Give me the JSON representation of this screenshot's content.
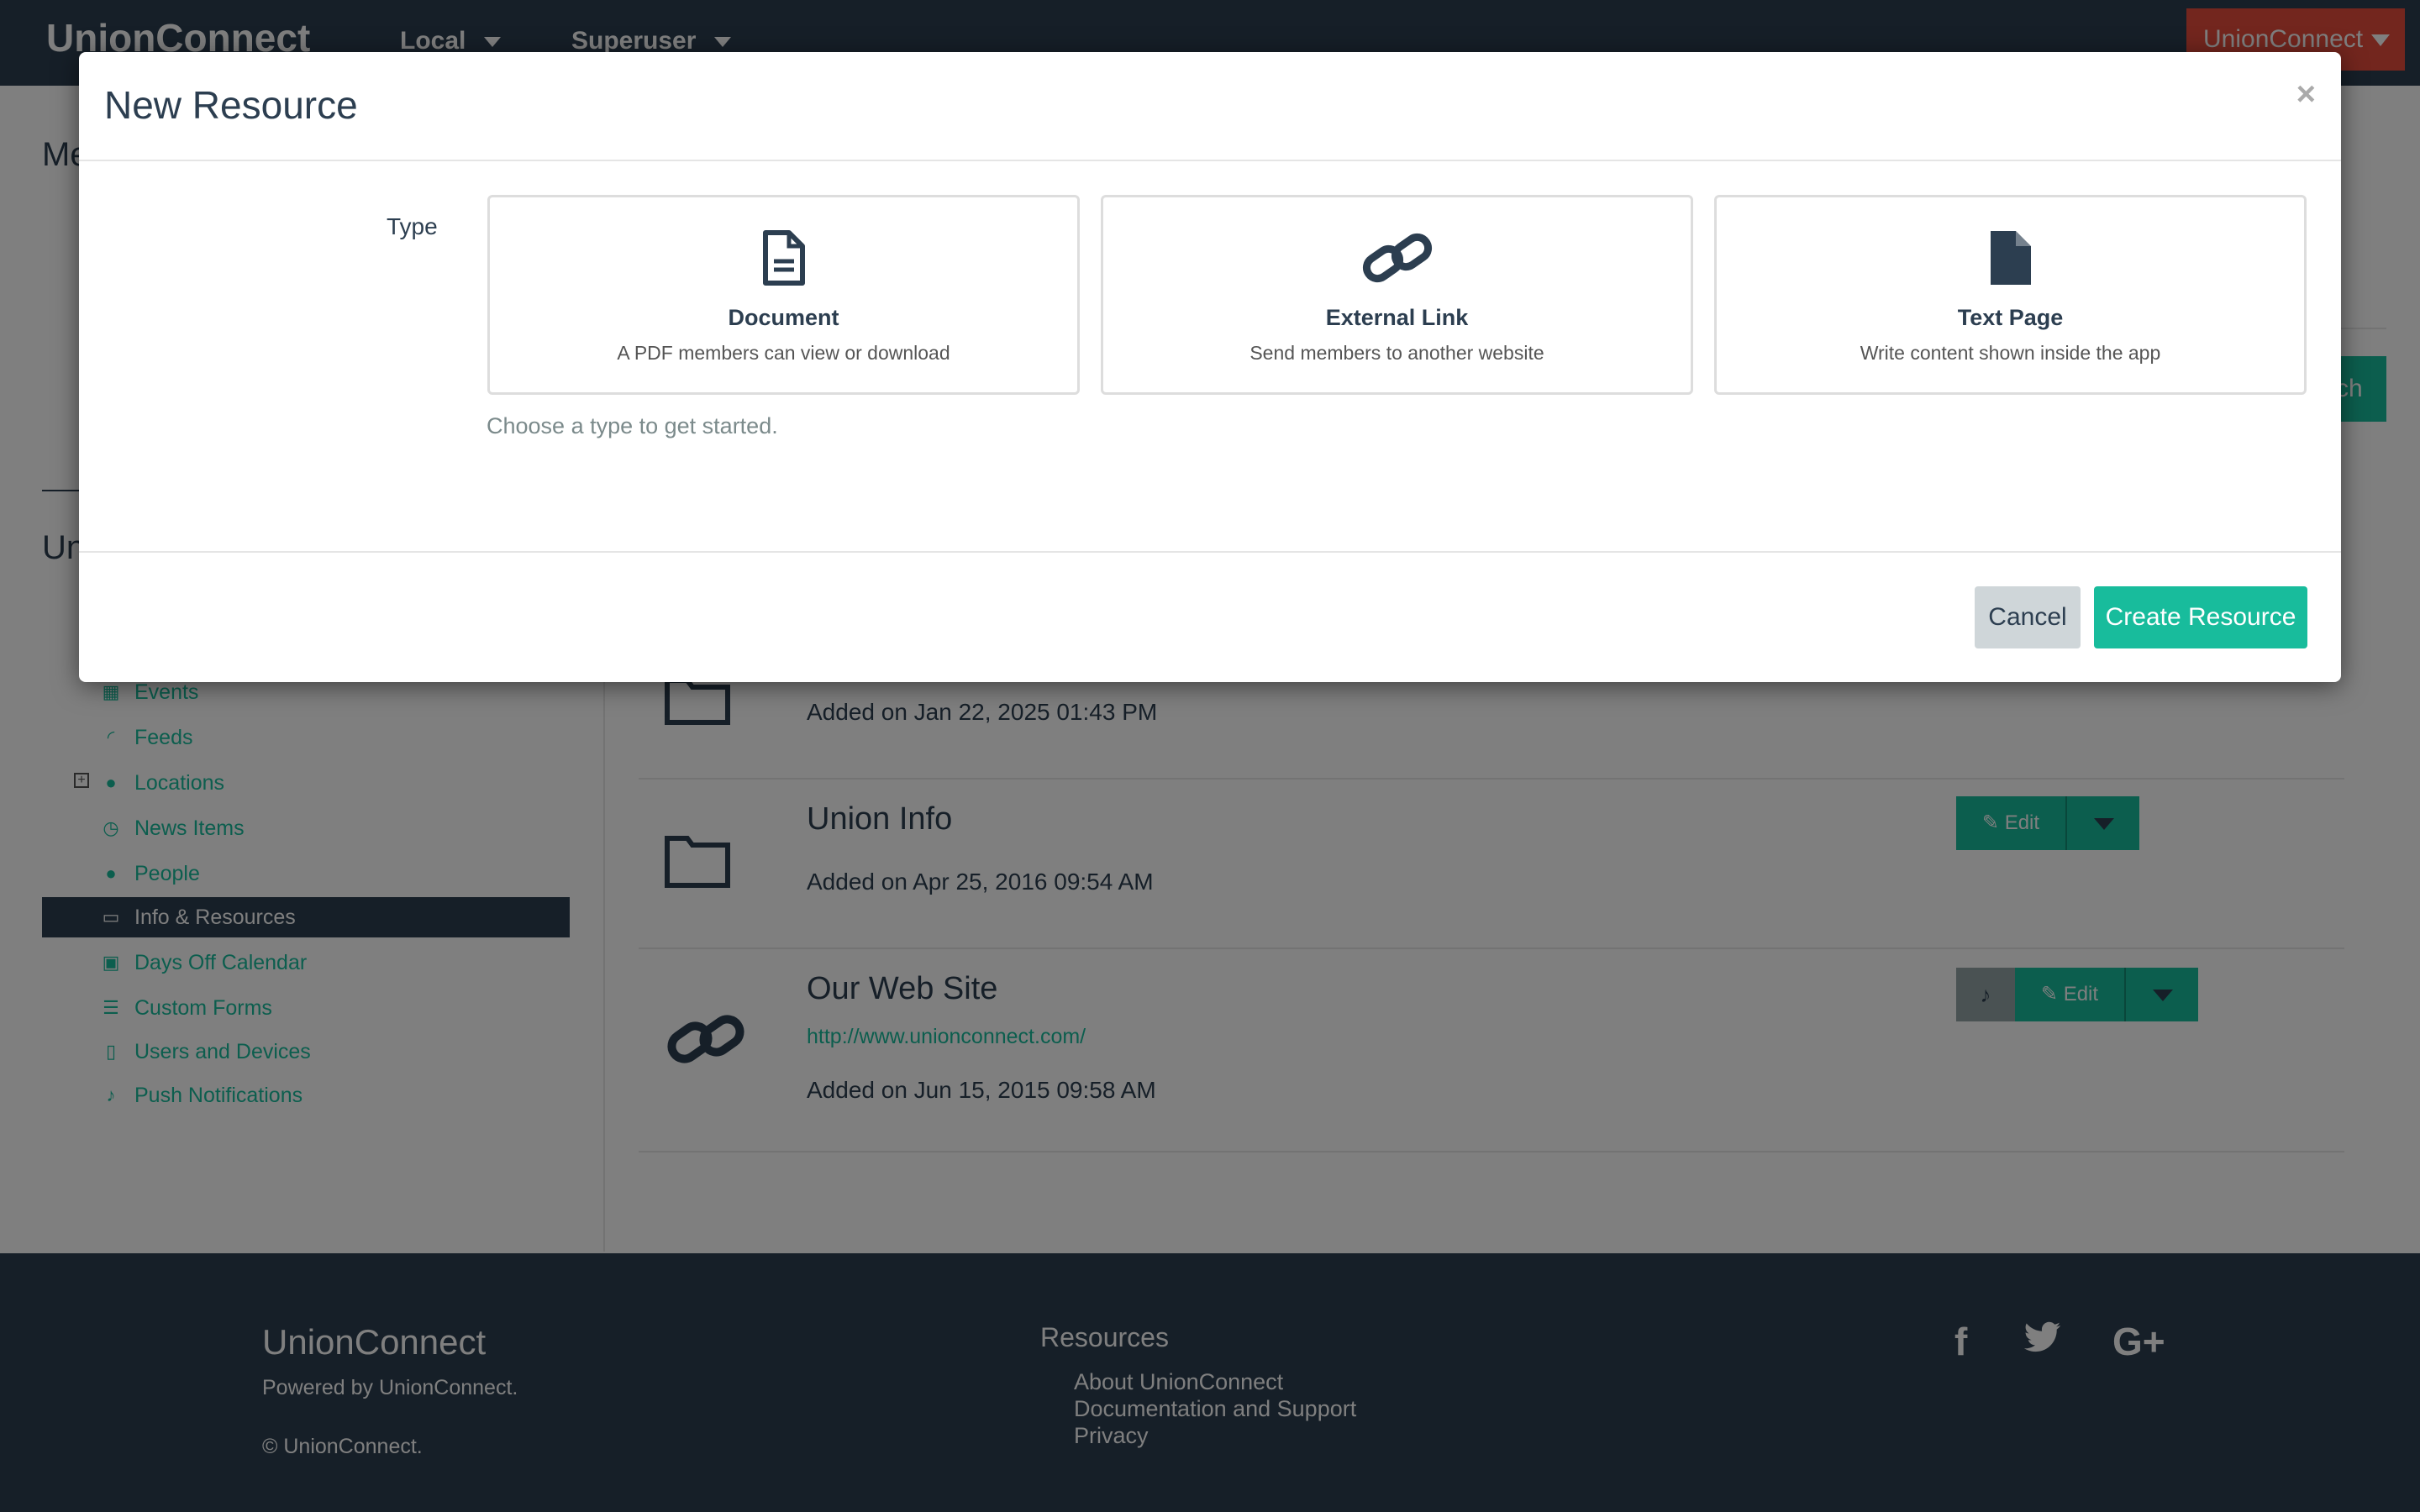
{
  "navbar": {
    "brand": "UnionConnect",
    "local_label": "Local",
    "superuser_label": "Superuser",
    "account_label": "UnionConnect"
  },
  "page": {
    "heading_top": "Me",
    "heading_mid": "Un",
    "search_button": "ch"
  },
  "sidebar": {
    "items": [
      {
        "label": "Events",
        "icon": "calendar-grid-icon"
      },
      {
        "label": "Feeds",
        "icon": "rss-icon"
      },
      {
        "label": "Locations",
        "icon": "globe-icon"
      },
      {
        "label": "News Items",
        "icon": "clock-icon"
      },
      {
        "label": "People",
        "icon": "user-icon"
      },
      {
        "label": "Info & Resources",
        "icon": "folder-open-icon"
      },
      {
        "label": "Days Off Calendar",
        "icon": "calendar-icon"
      },
      {
        "label": "Custom Forms",
        "icon": "list-alt-icon"
      },
      {
        "label": "Users and Devices",
        "icon": "tablet-icon"
      },
      {
        "label": "Push Notifications",
        "icon": "bell-icon"
      }
    ]
  },
  "resources": [
    {
      "title": "",
      "date": "Added on Jan 22, 2025 01:43 PM",
      "icon": "folder-icon"
    },
    {
      "title": "Union Info",
      "date": "Added on Apr 25, 2016 09:54 AM",
      "icon": "folder-icon",
      "edit_label": "Edit"
    },
    {
      "title": "Our Web Site",
      "link": "http://www.unionconnect.com/",
      "date": "Added on Jun 15, 2015 09:58 AM",
      "icon": "link-icon",
      "edit_label": "Edit"
    }
  ],
  "footer": {
    "brand": "UnionConnect",
    "powered": "Powered by UnionConnect.",
    "copyright": "© UnionConnect.",
    "resources_title": "Resources",
    "links": [
      "About UnionConnect",
      "Documentation and Support",
      "Privacy"
    ],
    "social": [
      "facebook-icon",
      "twitter-icon",
      "google-plus-icon"
    ],
    "social_glyphs": {
      "facebook": "f",
      "google_plus": "G+"
    }
  },
  "modal": {
    "title": "New Resource",
    "close": "×",
    "type_label": "Type",
    "types": [
      {
        "title": "Document",
        "desc": "A PDF members can view or download",
        "icon": "document-icon"
      },
      {
        "title": "External Link",
        "desc": "Send members to another website",
        "icon": "link-icon"
      },
      {
        "title": "Text Page",
        "desc": "Write content shown inside the app",
        "icon": "file-icon"
      }
    ],
    "hint": "Choose a type to get started.",
    "cancel": "Cancel",
    "create": "Create Resource"
  },
  "colors": {
    "navbar": "#2c3e50",
    "accent": "#18bc9c",
    "danger": "#e74c3c"
  }
}
